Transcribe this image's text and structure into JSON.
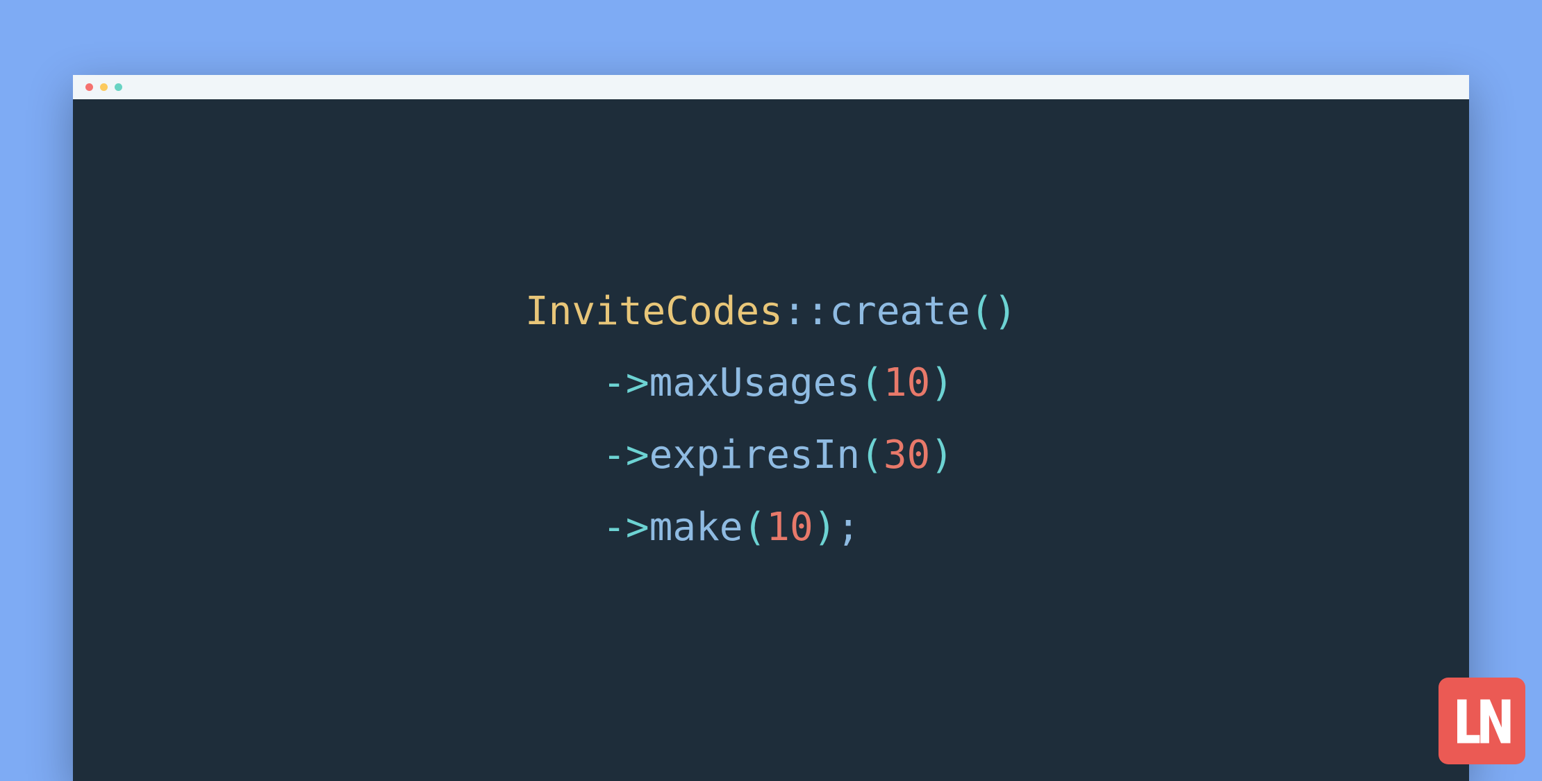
{
  "code": {
    "line1": {
      "class": "InviteCodes",
      "scope": "::",
      "method": "create",
      "paren_open": "(",
      "paren_close": ")"
    },
    "line2": {
      "arrow": "->",
      "method": "maxUsages",
      "paren_open": "(",
      "number": "10",
      "paren_close": ")"
    },
    "line3": {
      "arrow": "->",
      "method": "expiresIn",
      "paren_open": "(",
      "number": "30",
      "paren_close": ")"
    },
    "line4": {
      "arrow": "->",
      "method": "make",
      "paren_open": "(",
      "number": "10",
      "paren_close": ")",
      "semi": ";"
    }
  },
  "logo": {
    "text": "LN"
  },
  "colors": {
    "background": "#7eabf4",
    "editor": "#1e2d3a",
    "titlebar": "#f1f6f9",
    "logo": "#eb5a54"
  }
}
